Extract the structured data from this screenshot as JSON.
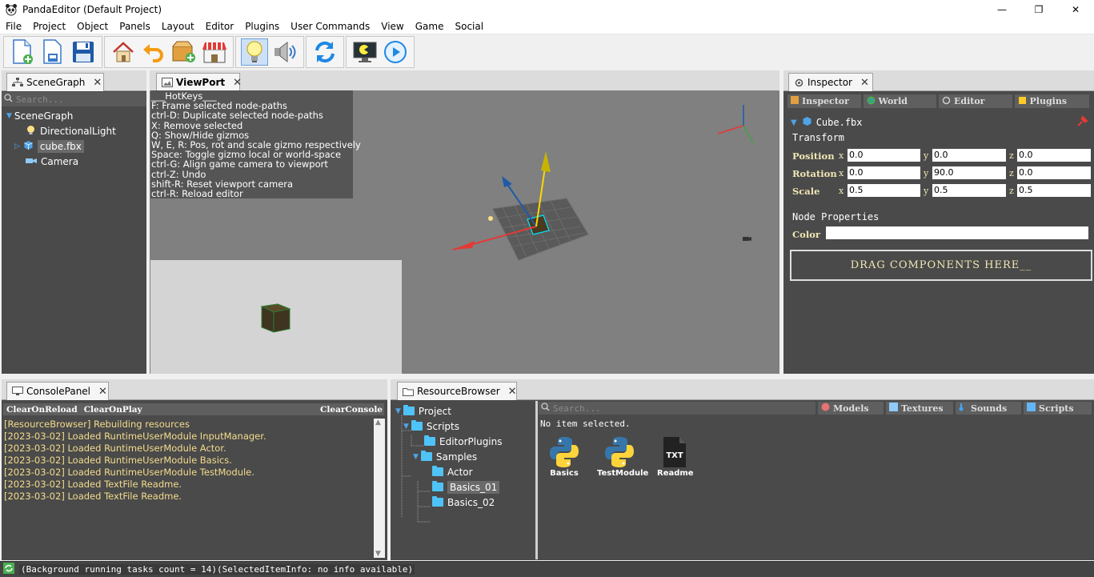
{
  "window": {
    "title": "PandaEditor (Default Project)",
    "minimize": "—",
    "maximize": "❐",
    "close": "✕"
  },
  "menu": [
    "File",
    "Project",
    "Object",
    "Panels",
    "Layout",
    "Editor",
    "Plugins",
    "User Commands",
    "View",
    "Game",
    "Social"
  ],
  "toolbar": {
    "groups": [
      [
        "new-file-icon",
        "save-as-icon",
        "save-icon"
      ],
      [
        "home-icon",
        "undo-icon",
        "add-package-icon",
        "store-icon"
      ],
      [
        "light-bulb-icon",
        "speaker-icon"
      ],
      [
        "refresh-icon"
      ],
      [
        "game-monitor-icon",
        "play-icon"
      ]
    ]
  },
  "scenegraph": {
    "tab": "SceneGraph",
    "search_placeholder": "Search...",
    "root": "SceneGraph",
    "items": [
      "DirectionalLight",
      "cube.fbx",
      "Camera"
    ]
  },
  "viewport": {
    "tab": "ViewPort",
    "hotkeys": [
      "___HotKeys___",
      "F: Frame selected node-paths",
      "ctrl-D: Duplicate selected node-paths",
      "X: Remove selected",
      "Q: Show/Hide gizmos",
      "W, E, R: Pos, rot and scale gizmo respectively",
      "Space: Toggle gizmo local or world-space",
      "ctrl-G: Align game camera to viewport",
      "ctrl-Z: Undo",
      "shift-R: Reset viewport camera",
      "ctrl-R: Reload editor"
    ]
  },
  "inspector": {
    "tab": "Inspector",
    "subtabs": [
      "Inspector",
      "World",
      "Editor",
      "Plugins"
    ],
    "object_name": "Cube.fbx",
    "transform_label": "Transform",
    "position_label": "Position",
    "rotation_label": "Rotation",
    "scale_label": "Scale",
    "axis_x": "x",
    "axis_y": "y",
    "axis_z": "z",
    "position": [
      "0.0",
      "0.0",
      "0.0"
    ],
    "rotation": [
      "0.0",
      "90.0",
      "0.0"
    ],
    "scale": [
      "0.5",
      "0.5",
      "0.5"
    ],
    "node_properties_label": "Node Properties",
    "color_label": "Color",
    "drag_components": "DRAG COMPONENTS HERE__"
  },
  "console": {
    "tab": "ConsolePanel",
    "clear_on_reload": "ClearOnReload",
    "clear_on_play": "ClearOnPlay",
    "clear_console": "ClearConsole",
    "lines": [
      "[ResourceBrowser] Rebuilding resources",
      "[2023-03-02] Loaded RuntimeUserModule InputManager.",
      "[2023-03-02] Loaded RuntimeUserModule Actor.",
      "[2023-03-02] Loaded RuntimeUserModule Basics.",
      "[2023-03-02] Loaded RuntimeUserModule TestModule.",
      "[2023-03-02] Loaded TextFile Readme.",
      "[2023-03-02] Loaded TextFile Readme."
    ]
  },
  "resources": {
    "tab": "ResourceBrowser",
    "tree": {
      "project": "Project",
      "scripts": "Scripts",
      "editor_plugins": "EditorPlugins",
      "samples": "Samples",
      "actor": "Actor",
      "basics_01": "Basics_01",
      "basics_02": "Basics_02"
    },
    "search_placeholder": "Search...",
    "filters": [
      "Models",
      "Textures",
      "Sounds",
      "Scripts"
    ],
    "info": "No item selected.",
    "items": [
      {
        "label": "Basics",
        "icon": "python-icon"
      },
      {
        "label": "TestModule",
        "icon": "python-icon"
      },
      {
        "label": "Readme",
        "icon": "txt-file-icon",
        "badge": "TXT"
      }
    ]
  },
  "status": "(Background running tasks count = 14)(SelectedItemInfo: no info available)"
}
